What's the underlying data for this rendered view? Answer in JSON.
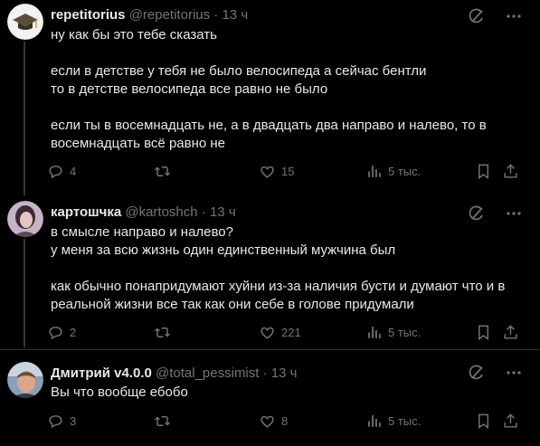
{
  "posts": [
    {
      "name": "repetitorius",
      "handle": "@repetitorius",
      "dot": "·",
      "time": "13 ч",
      "lines": [
        "ну как бы это тебе сказать",
        "",
        "если в детстве у тебя не было велосипеда а сейчас бентли",
        "то в детстве велосипеда все равно не было",
        "",
        "если ты в восемнадцать не, а в двадцать два направо и налево, то в",
        "восемнадцать всё равно не"
      ],
      "replies": "4",
      "reposts": "",
      "likes": "15",
      "views": "5 тыс."
    },
    {
      "name": "картошчка",
      "handle": "@kartoshch",
      "dot": "·",
      "time": "13 ч",
      "lines": [
        "в смысле направо и налево?",
        "у меня за всю жизнь один  единственный мужчина был",
        "",
        "как обычно понапридумают хуйни из-за наличия бусти и думают что и в",
        "реальной жизни все так как они себе в голове придумали"
      ],
      "replies": "2",
      "reposts": "",
      "likes": "221",
      "views": "5 тыс."
    },
    {
      "name": "Дмитрий v4.0.0",
      "handle": "@total_pessimist",
      "dot": "·",
      "time": "13 ч",
      "lines": [
        "Вы что вообще ебобо"
      ],
      "replies": "3",
      "reposts": "",
      "likes": "8",
      "views": "5 тыс."
    }
  ],
  "icons": {
    "reply": "reply-icon",
    "repost": "repost-icon",
    "like": "heart-icon",
    "views": "views-icon",
    "bookmark": "bookmark-icon",
    "share": "share-icon",
    "grok": "grok-icon",
    "more": "more-icon"
  },
  "colors": {
    "background": "#000000",
    "text": "#e7e9ea",
    "muted": "#71767b",
    "divider": "#2f3336"
  }
}
